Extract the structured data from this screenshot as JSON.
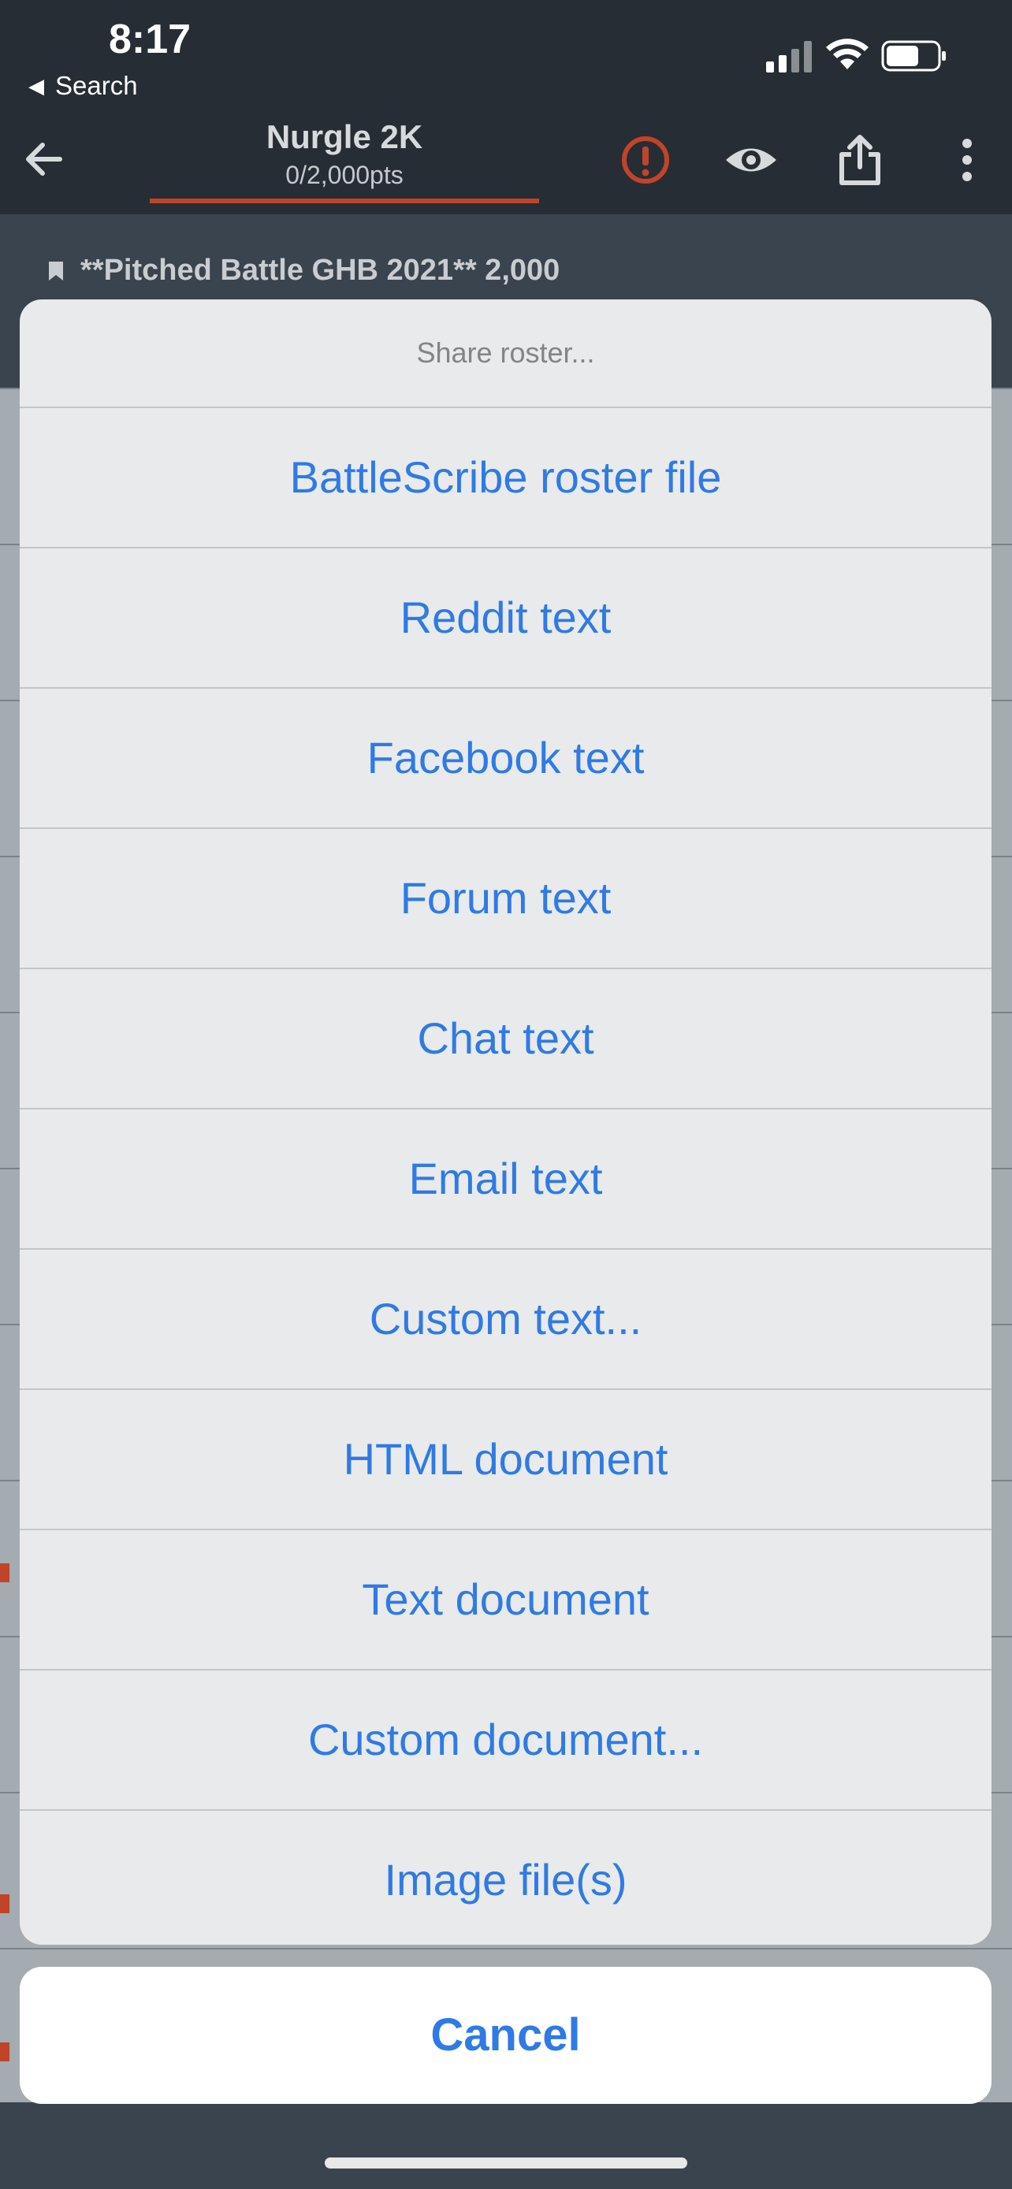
{
  "status_bar": {
    "time": "8:17",
    "back_app": "Search"
  },
  "nav": {
    "title": "Nurgle 2K",
    "subtitle": "0/2,000pts",
    "accent_color": "#c0442a",
    "icons": [
      "back-arrow-icon",
      "alert-icon",
      "eye-icon",
      "share-icon",
      "more-vertical-icon"
    ]
  },
  "roster": {
    "title": "**Pitched Battle GHB 2021** 2,000"
  },
  "share_sheet": {
    "title": "Share roster...",
    "items": [
      "BattleScribe roster file",
      "Reddit text",
      "Facebook text",
      "Forum text",
      "Chat text",
      "Email text",
      "Custom text...",
      "HTML document",
      "Text document",
      "Custom document...",
      "Image file(s)"
    ],
    "cancel": "Cancel",
    "action_color": "#2f7ae5"
  }
}
